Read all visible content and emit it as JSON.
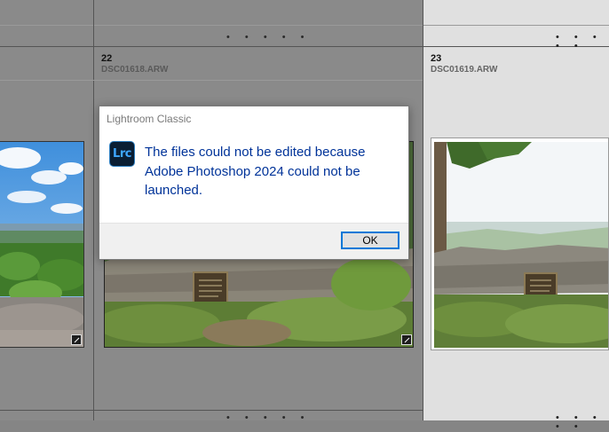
{
  "cells": [
    {
      "number": "22",
      "filename": "DSC01618.ARW"
    },
    {
      "number": "23",
      "filename": "DSC01619.ARW"
    }
  ],
  "rating_dots": "• • • • •",
  "badge_icon": "edit-badge-icon",
  "dialog": {
    "title": "Lightroom Classic",
    "icon_text": "Lrc",
    "message": "The files could not be edited because Adobe Photoshop 2024 could not be launched.",
    "ok_label": "OK",
    "accent_color": "#0078d7",
    "message_color": "#003399"
  }
}
